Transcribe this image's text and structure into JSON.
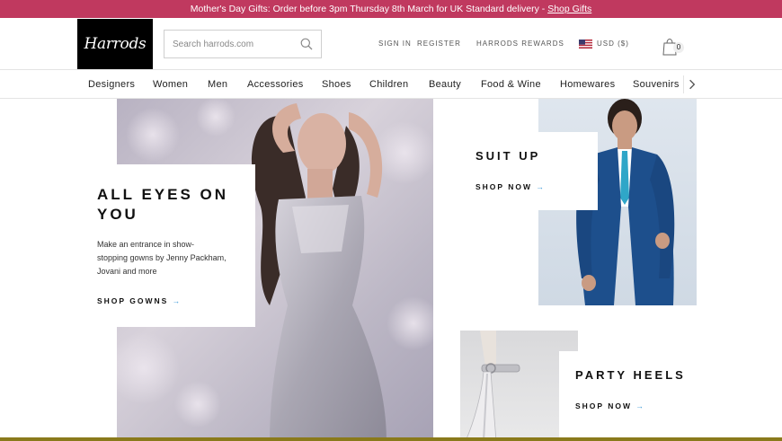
{
  "promo": {
    "text": "Mother's Day Gifts: Order before 3pm Thursday 8th March for UK Standard delivery - ",
    "link": "Shop Gifts",
    "color": "#c0395f"
  },
  "header": {
    "logo": "Harrods",
    "search_placeholder": "Search harrods.com",
    "sign_in": "SIGN IN",
    "register": "REGISTER",
    "rewards": "HARRODS REWARDS",
    "currency": "USD ($)",
    "bag_count": "0",
    "icons": [
      "search-icon",
      "us-flag-icon",
      "shopping-bag-icon"
    ]
  },
  "nav": {
    "items": [
      "Designers",
      "Women",
      "Men",
      "Accessories",
      "Shoes",
      "Children",
      "Beauty",
      "Food & Wine",
      "Homewares",
      "Souvenirs"
    ]
  },
  "hero": {
    "title_line1": "ALL EYES ON",
    "title_line2": "YOU",
    "description_line1": "Make an entrance in show-",
    "description_line2": "stopping gowns by Jenny Packham,",
    "description_line3": "Jovani and more",
    "cta": "SHOP GOWNS",
    "arrow": "→"
  },
  "suit": {
    "title": "SUIT UP",
    "cta": "SHOP NOW",
    "arrow": "→"
  },
  "heels": {
    "title": "PARTY HEELS",
    "cta": "SHOP NOW",
    "arrow": "→"
  },
  "colors": {
    "accent": "#3c9ad7",
    "promo_bar": "#c0395f",
    "bottom_bar": "#8a7a1b"
  }
}
